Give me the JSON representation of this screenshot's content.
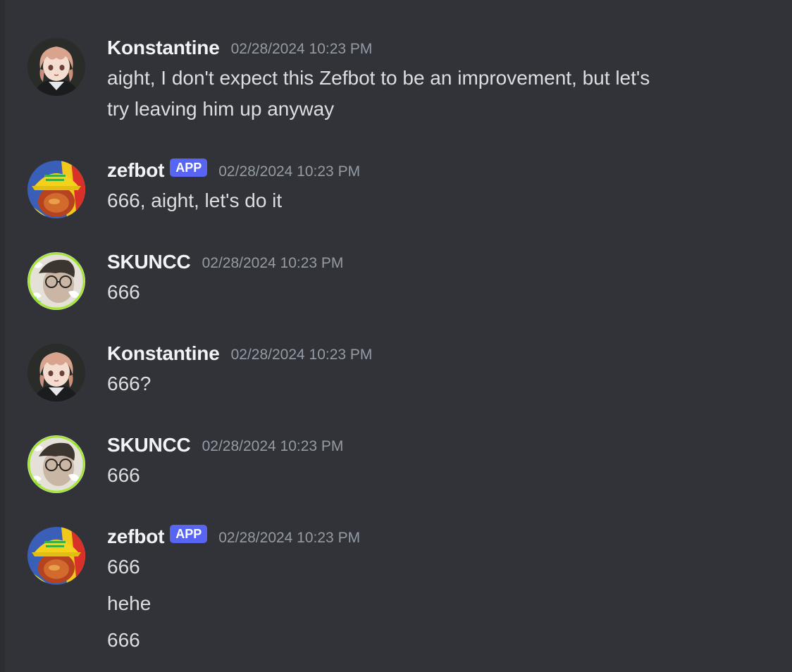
{
  "messages": [
    {
      "username": "Konstantine",
      "avatar_icon": "anime-character-avatar",
      "timestamp": "02/28/2024 10:23 PM",
      "lines": [
        "aight, I don't expect this Zefbot to be an improvement, but let's",
        "try leaving him up anyway"
      ]
    },
    {
      "username": "zefbot",
      "badge": "APP",
      "avatar_icon": "yellow-hat-bird-avatar",
      "timestamp": "02/28/2024 10:23 PM",
      "lines": [
        "666, aight, let's do it"
      ]
    },
    {
      "username": "SKUNCC",
      "avatar_icon": "person-glasses-avatar",
      "timestamp": "02/28/2024 10:23 PM",
      "lines": [
        "666"
      ]
    },
    {
      "username": "Konstantine",
      "avatar_icon": "anime-character-avatar",
      "timestamp": "02/28/2024 10:23 PM",
      "lines": [
        "666?"
      ]
    },
    {
      "username": "SKUNCC",
      "avatar_icon": "person-glasses-avatar",
      "timestamp": "02/28/2024 10:23 PM",
      "lines": [
        "666"
      ]
    },
    {
      "username": "zefbot",
      "badge": "APP",
      "avatar_icon": "yellow-hat-bird-avatar",
      "timestamp": "02/28/2024 10:23 PM",
      "lines": [
        "666",
        "hehe",
        "666"
      ]
    }
  ],
  "colors": {
    "background": "#313338",
    "username": "#f2f3f5",
    "message_text": "#dbdee1",
    "timestamp": "#949ba4",
    "app_badge": "#5865f2",
    "avatar_ring": "#a3e635"
  }
}
